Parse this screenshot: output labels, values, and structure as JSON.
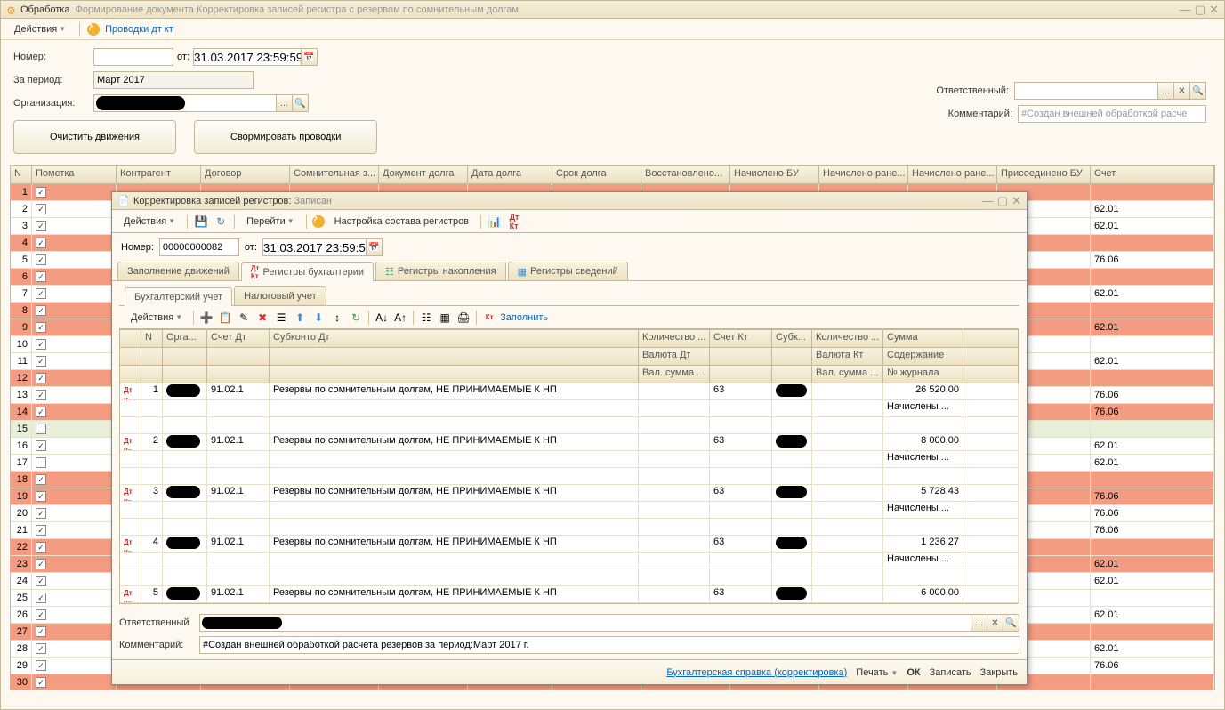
{
  "main_window": {
    "title_prefix": "Обработка",
    "title": "Формирование документа Корректировка записей регистра с резервом по сомнительным долгам",
    "menu_actions": "Действия",
    "link_provodki": "Проводки дт кт"
  },
  "form": {
    "label_number": "Номер:",
    "label_ot": "от:",
    "value_date": "31.03.2017 23:59:59",
    "label_period": "За период:",
    "value_period": "Март 2017",
    "label_org": "Организация:",
    "label_resp": "Ответственный:",
    "label_comment": "Комментарий:",
    "value_comment_placeholder": "#Создан внешней обработкой расче",
    "btn_clear": "Очистить движения",
    "btn_form": "Свормировать проводки"
  },
  "grid": {
    "headers": {
      "n": "N",
      "mark": "Пометка",
      "contragent": "Контрагент",
      "dogovor": "Договор",
      "somnit": "Сомнительная з...",
      "docdolg": "Документ долга",
      "datadolg": "Дата долга",
      "srokdolg": "Срок долга",
      "vosstan": "Восстановлено...",
      "nachisbu": "Начислено БУ",
      "nachran1": "Начислено ране...",
      "nachran2": "Начислено ране...",
      "prisoed": "Присоединено БУ",
      "schet": "Счет"
    },
    "rows": [
      {
        "n": 1,
        "chk": true,
        "red": true,
        "schet": ""
      },
      {
        "n": 2,
        "chk": true,
        "red": false,
        "schet": "62.01"
      },
      {
        "n": 3,
        "chk": true,
        "red": false,
        "schet": "62.01"
      },
      {
        "n": 4,
        "chk": true,
        "red": true,
        "schet": ""
      },
      {
        "n": 5,
        "chk": true,
        "red": false,
        "schet": "76.06"
      },
      {
        "n": 6,
        "chk": true,
        "red": true,
        "schet": ""
      },
      {
        "n": 7,
        "chk": true,
        "red": false,
        "schet": "62.01"
      },
      {
        "n": 8,
        "chk": true,
        "red": true,
        "schet": ""
      },
      {
        "n": 9,
        "chk": true,
        "red": true,
        "schet": "62.01"
      },
      {
        "n": 10,
        "chk": true,
        "red": false,
        "schet": ""
      },
      {
        "n": 11,
        "chk": true,
        "red": false,
        "schet": "62.01"
      },
      {
        "n": 12,
        "chk": true,
        "red": true,
        "schet": ""
      },
      {
        "n": 13,
        "chk": true,
        "red": false,
        "schet": "76.06"
      },
      {
        "n": 14,
        "chk": true,
        "red": true,
        "schet": "76.06"
      },
      {
        "n": 15,
        "chk": false,
        "red": false,
        "schet": "",
        "sel": true
      },
      {
        "n": 16,
        "chk": true,
        "red": false,
        "schet": "62.01"
      },
      {
        "n": 17,
        "chk": false,
        "red": false,
        "schet": "62.01"
      },
      {
        "n": 18,
        "chk": true,
        "red": true,
        "schet": ""
      },
      {
        "n": 19,
        "chk": true,
        "red": true,
        "schet": "76.06"
      },
      {
        "n": 20,
        "chk": true,
        "red": false,
        "schet": "76.06"
      },
      {
        "n": 21,
        "chk": true,
        "red": false,
        "schet": "76.06"
      },
      {
        "n": 22,
        "chk": true,
        "red": true,
        "schet": ""
      },
      {
        "n": 23,
        "chk": true,
        "red": true,
        "schet": "62.01"
      },
      {
        "n": 24,
        "chk": true,
        "red": false,
        "schet": "62.01"
      },
      {
        "n": 25,
        "chk": true,
        "red": false,
        "schet": ""
      },
      {
        "n": 26,
        "chk": true,
        "red": false,
        "schet": "62.01"
      },
      {
        "n": 27,
        "chk": true,
        "red": true,
        "schet": ""
      },
      {
        "n": 28,
        "chk": true,
        "red": false,
        "schet": "62.01"
      },
      {
        "n": 29,
        "chk": true,
        "red": false,
        "schet": "76.06"
      },
      {
        "n": 30,
        "chk": true,
        "red": true,
        "schet": ""
      }
    ]
  },
  "dialog": {
    "title_main": "Корректировка записей регистров:",
    "title_status": "Записан",
    "menu_actions": "Действия",
    "menu_goto": "Перейти",
    "menu_registers": "Настройка состава регистров",
    "label_number": "Номер:",
    "value_number": "00000000082",
    "label_ot": "от:",
    "value_date": "31.03.2017 23:59:59",
    "tabs_outer": [
      {
        "label": "Заполнение движений",
        "active": false
      },
      {
        "label": "Регистры бухгалтерии",
        "active": true,
        "icon": "dk"
      },
      {
        "label": "Регистры накопления",
        "active": false,
        "icon": "reg"
      },
      {
        "label": "Регистры сведений",
        "active": false,
        "icon": "table"
      }
    ],
    "tabs_inner": [
      {
        "label": "Бухгалтерский учет",
        "active": true
      },
      {
        "label": "Налоговый учет",
        "active": false
      }
    ],
    "inner_menu_actions": "Действия",
    "btn_fill": "Заполнить",
    "inner_headers": {
      "blank1": "",
      "n": "N",
      "org": "Орга...",
      "schetdt": "Счет Дт",
      "subdt": "Субконто Дт",
      "koldt": "Количество ...",
      "schetkt": "Счет Кт",
      "subkt": "Субк...",
      "kolkt": "Количество ...",
      "summa": "Сумма",
      "valdt": "Валюта Дт",
      "valkt": "Валюта Кт",
      "soder": "Содержание",
      "valsumdt": "Вал. сумма ...",
      "valsumkt": "Вал. сумма ...",
      "journal": "№ журнала"
    },
    "inner_rows": [
      {
        "n": 1,
        "schetdt": "91.02.1",
        "subdt": "Резервы по сомнительным долгам, НЕ ПРИНИМАЕМЫЕ К НП",
        "schetkt": "63",
        "summa": "26 520,00",
        "soder": "Начислены ..."
      },
      {
        "n": 2,
        "schetdt": "91.02.1",
        "subdt": "Резервы по сомнительным долгам, НЕ ПРИНИМАЕМЫЕ К НП",
        "schetkt": "63",
        "summa": "8 000,00",
        "soder": "Начислены ..."
      },
      {
        "n": 3,
        "schetdt": "91.02.1",
        "subdt": "Резервы по сомнительным долгам, НЕ ПРИНИМАЕМЫЕ К НП",
        "schetkt": "63",
        "summa": "5 728,43",
        "soder": "Начислены ..."
      },
      {
        "n": 4,
        "schetdt": "91.02.1",
        "subdt": "Резервы по сомнительным долгам, НЕ ПРИНИМАЕМЫЕ К НП",
        "schetkt": "63",
        "summa": "1 236,27",
        "soder": "Начислены ..."
      },
      {
        "n": 5,
        "schetdt": "91.02.1",
        "subdt": "Резервы по сомнительным долгам, НЕ ПРИНИМАЕМЫЕ К НП",
        "schetkt": "63",
        "summa": "6 000,00",
        "soder": ""
      }
    ],
    "label_resp": "Ответственный",
    "label_comment": "Комментарий:",
    "value_comment": "#Создан внешней обработкой расчета резервов за период:Март 2017 г.",
    "footer": {
      "link": "Бухгалтерская справка (корректировка)",
      "print": "Печать",
      "ok": "ОК",
      "save": "Записать",
      "close": "Закрыть"
    }
  }
}
